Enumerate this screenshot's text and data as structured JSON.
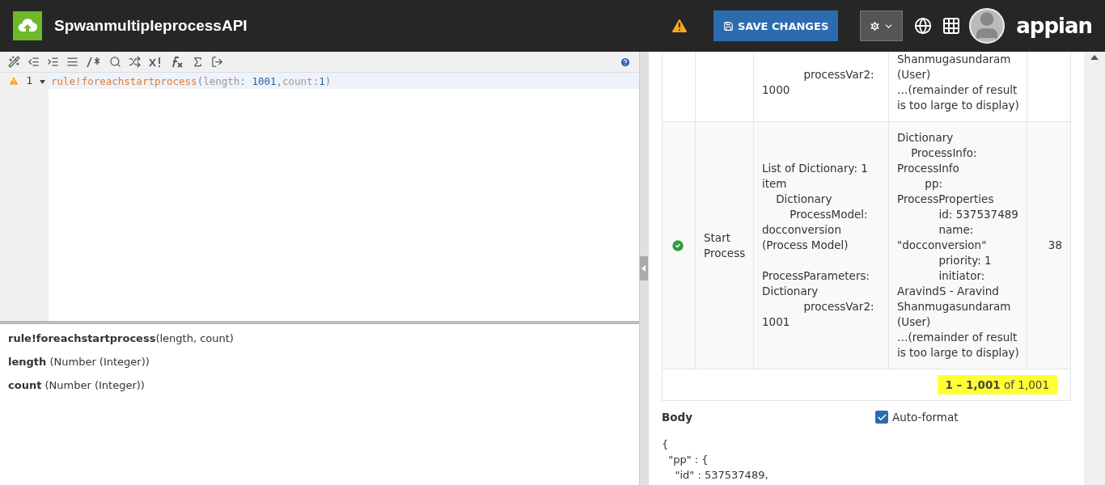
{
  "header": {
    "title": "SpwanmultipleprocessAPI",
    "save_label": "SAVE CHANGES",
    "brand": "appian"
  },
  "editor": {
    "lines": [
      {
        "number": "1",
        "tokens": [
          {
            "kind": "fn",
            "text": "rule!foreachstartprocess"
          },
          {
            "kind": "punct",
            "text": "("
          },
          {
            "kind": "param",
            "text": "length"
          },
          {
            "kind": "punct",
            "text": ": "
          },
          {
            "kind": "num",
            "text": "1001"
          },
          {
            "kind": "punct",
            "text": ","
          },
          {
            "kind": "param",
            "text": "count"
          },
          {
            "kind": "punct",
            "text": ":"
          },
          {
            "kind": "num",
            "text": "1"
          },
          {
            "kind": "punct",
            "text": ")"
          }
        ]
      }
    ]
  },
  "help": [
    "**rule!foreachstartprocess**(length, count)",
    "**length** (Number (Integer))",
    "**count** (Number (Integer))"
  ],
  "results": {
    "rows": [
      {
        "name": "",
        "params": "            processVar2:\n1000",
        "result": "Shanmugasundaram\n(User)\n…(remainder of result\nis too large to display)",
        "time": ""
      },
      {
        "succeeded": true,
        "name": "Start\nProcess",
        "params": "List of Dictionary: 1\nitem\n    Dictionary\n        ProcessModel:\ndocconversion\n(Process Model)\n\nProcessParameters:\nDictionary\n            processVar2:\n1001",
        "result": "Dictionary\n    ProcessInfo:\nProcessInfo\n        pp:\nProcessProperties\n            id: 537537489\n            name:\n\"docconversion\"\n            priority: 1\n            initiator:\nAravindS - Aravind\nShanmugasundaram\n(User)\n…(remainder of result\nis too large to display)",
        "time": "38"
      }
    ],
    "pager": "**1 – 1,001** of 1,001"
  },
  "body": {
    "label": "Body",
    "auto_format": {
      "label": "Auto-format",
      "checked": true
    },
    "code": "{\n  \"pp\" : {\n    \"id\" : 537537489,"
  }
}
